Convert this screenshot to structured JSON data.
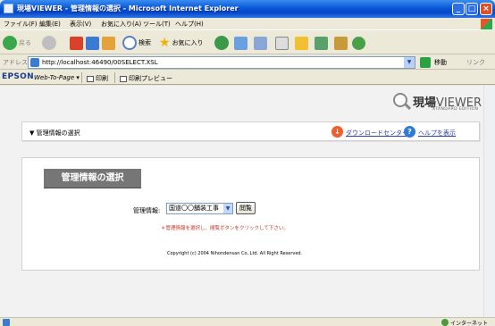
{
  "window": {
    "title": "現場VIEWER - 管理情報の選択 - Microsoft Internet Explorer",
    "controls": {
      "minimize": "_",
      "maximize": "□",
      "close": "×"
    }
  },
  "menu": [
    "ファイル(F)",
    "編集(E)",
    "表示(V)",
    "お気に入り(A)",
    "ツール(T)",
    "ヘルプ(H)"
  ],
  "toolbar": {
    "back_label": "戻る",
    "search_label": "検索",
    "favorites_label": "お気に入り"
  },
  "address": {
    "label": "アドレス(D)",
    "url": "http://localhost:46490/00SELECT.XSL",
    "go_label": "移動",
    "links_label": "リンク"
  },
  "epson_bar": {
    "logo": "EPSON",
    "web_to_page": "Web-To-Page",
    "print_label": "印刷",
    "preview_label": "印刷プレビュー"
  },
  "page": {
    "logo_main": "現場",
    "logo_viewer": "VIEWER",
    "logo_sub": "STANDARD EDITION",
    "header_title": "▼ 管理情報の選択",
    "download_link": "ダウンロードセンター",
    "help_link": "ヘルプを表示",
    "section_title": "管理情報の選択",
    "select_label": "管理情報:",
    "select_value": "国道〇〇舗装工事",
    "view_button": "閲覧",
    "hint": "＊管理情報を選択し、閲覧ボタンをクリックして下さい。",
    "copyright": "Copyright (c) 2004 Nihondensan Co, Ltd. All Right Reserved."
  },
  "status": {
    "zone": "インターネット"
  },
  "colors": {
    "titlebar": "#0a58d8",
    "section_title_bg": "#767676",
    "link": "#2b3fb0",
    "hint": "#c0392b"
  }
}
